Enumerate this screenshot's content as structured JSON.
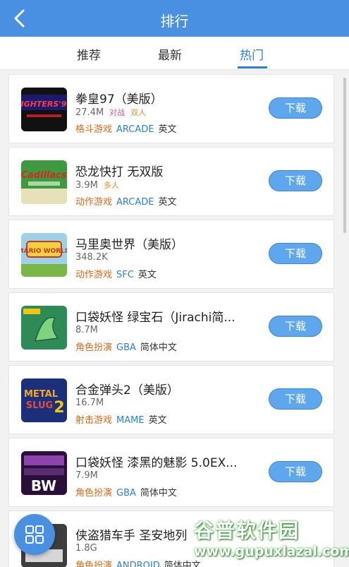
{
  "header": {
    "title": "排行"
  },
  "tabs": [
    {
      "label": "推荐"
    },
    {
      "label": "最新"
    },
    {
      "label": "热门"
    }
  ],
  "games": [
    {
      "name": "拳皇97（美版）",
      "size": "27.4M",
      "tags": [
        "对战",
        "双人"
      ],
      "category": "格斗游戏",
      "platform": "ARCADE",
      "language": "英文"
    },
    {
      "name": "恐龙快打 无双版",
      "size": "3.9M",
      "tags": [
        "多人"
      ],
      "category": "动作游戏",
      "platform": "ARCADE",
      "language": "英文"
    },
    {
      "name": "马里奥世界（美版）",
      "size": "348.2K",
      "tags": [],
      "category": "动作游戏",
      "platform": "SFC",
      "language": "英文"
    },
    {
      "name": "口袋妖怪 绿宝石（Jirachi简...",
      "size": "8.7M",
      "tags": [],
      "category": "角色扮演",
      "platform": "GBA",
      "language": "简体中文"
    },
    {
      "name": "合金弹头2（美版）",
      "size": "16.7M",
      "tags": [],
      "category": "射击游戏",
      "platform": "MAME",
      "language": "英文"
    },
    {
      "name": "口袋妖怪 漆黑的魅影 5.0EX...",
      "size": "7.9M",
      "tags": [],
      "category": "角色扮演",
      "platform": "GBA",
      "language": "简体中文"
    },
    {
      "name": "侠盗猎车手 圣安地列",
      "size": "1.8G",
      "tags": [],
      "category": "角色扮演",
      "platform": "ANDROID",
      "language": "简体中文"
    }
  ],
  "download_label": "下载",
  "watermark": {
    "title": "谷普软件园",
    "url": "www.gupuxlazal.com"
  },
  "colors": {
    "accent": "#4a90e2",
    "active_tab": "#2a7fd6",
    "category": "#e06a1a"
  }
}
